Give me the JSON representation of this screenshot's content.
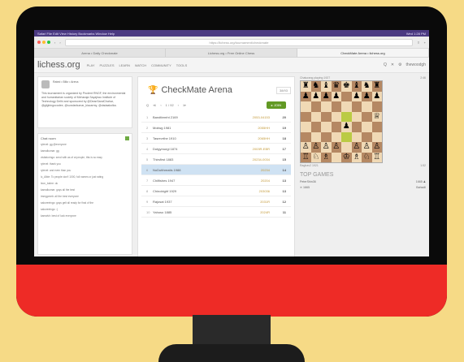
{
  "menubar": {
    "left": "Safari   File   Edit   View   History   Bookmarks   Window   Help",
    "right": "Wed 1:28 PM"
  },
  "browser": {
    "url": "https://lichess.org/tournament/checkmate",
    "tabs": [
      "Arena • Daily Checkmate",
      "Lichess.org • Free Online Chess",
      "CheckMate Arena • lichess.org"
    ]
  },
  "lichess": {
    "logo": "lichess.org",
    "nav": [
      "PLAY",
      "PUZZLES",
      "LEARN",
      "WATCH",
      "COMMUNITY",
      "TOOLS"
    ],
    "right": [
      "Q",
      "✕",
      "⚙",
      "thewoodgh"
    ]
  },
  "info": {
    "header": "Rated • Blitz • Arena",
    "body": "This tournament is organized by Prudent RNGF, the environmental and humanitarian society of Meharaja Sayajirao Institute of Technology Delhi and sponsored by @DeanSaraiChahar, @gfgbingocodee, @sundarkumar_kiacarmy, @dadaakolka."
  },
  "chat": {
    "title": "Chat room",
    "lines": [
      "rylevel: gg @everyone",
      "kamalkumar: gg",
      "visitatoringo: send with as of at people, this is so easy",
      "rylevel: thank you",
      "rylevel: and even than you",
      "lc_Albie: To people don't 1000, full names or just rating",
      "leon_bahre: ok",
      "kamalkumar: guys all the best",
      "immgpmeb: all the best everyone",
      "sakoreeingo: guys gelt all ready for final of the",
      "sakoreeingo: :)",
      "kamalvh: best of luck everyone"
    ]
  },
  "arena": {
    "title": "CheckMate Arena",
    "players_count": "38/93",
    "controls": [
      "Q",
      "≪",
      "‹",
      "1 / 92",
      "›",
      "≫"
    ],
    "join": "▸ JOIN",
    "rows": [
      {
        "rank": "1",
        "player": "Bandtbrmht 2169",
        "sheet": "2053-04153",
        "score": "20"
      },
      {
        "rank": "2",
        "player": "Moiiwg 1981",
        "sheet": "2055HH",
        "score": "19"
      },
      {
        "rank": "3",
        "player": "Tasrevrthe 1910",
        "sheet": "2065HH",
        "score": "18"
      },
      {
        "rank": "4",
        "player": "Dutgymurgl 1874",
        "sheet": "2003R-EBR",
        "score": "17"
      },
      {
        "rank": "5",
        "player": "Thirsfirst 1883",
        "sheet": "20234-0034",
        "score": "15"
      },
      {
        "rank": "6",
        "player": "NoDutthreatis 1988",
        "sheet": "20234",
        "score": "14"
      },
      {
        "rank": "7",
        "player": "Chilfishes 1947",
        "sheet": "20204",
        "score": "13"
      },
      {
        "rank": "8",
        "player": "Chinobighf 1929",
        "sheet": "203036",
        "score": "13"
      },
      {
        "rank": "9",
        "player": "Rajosat 1937",
        "sheet": "2031R",
        "score": "12"
      },
      {
        "rank": "10",
        "player": "Yahoso 1885",
        "sheet": "2024R",
        "score": "11"
      }
    ]
  },
  "board": {
    "top_player": "Chaturang playing 1927",
    "top_clock": "2:46",
    "bottom_player": "Raghav2 1921",
    "bottom_clock": "1:52",
    "pieces": [
      "♜",
      "♞",
      "♝",
      "♛",
      "♚",
      "♝",
      "♞",
      "♜",
      "♟",
      "♟",
      "♟",
      "♟",
      "",
      "♟",
      "♟",
      "♟",
      "",
      "",
      "",
      "",
      "",
      "",
      "",
      "",
      "",
      "",
      "",
      "",
      "",
      "",
      "",
      "♕",
      "",
      "",
      "",
      "",
      "♟",
      "",
      "",
      "",
      "",
      "",
      "",
      "",
      "",
      "",
      "",
      "",
      "♙",
      "♙",
      "♙",
      "♙",
      "",
      "♙",
      "♙",
      "♙",
      "♖",
      "♘",
      "♗",
      "",
      "♔",
      "♗",
      "♘",
      "♖"
    ],
    "highlight": [
      28,
      44
    ]
  },
  "top_games": {
    "title": "TOP GAMES",
    "rows": [
      {
        "left": "PeterShin36",
        "right": "1665 ♟"
      },
      {
        "left": "✕ 1665",
        "right": "Bahsdil"
      }
    ]
  }
}
